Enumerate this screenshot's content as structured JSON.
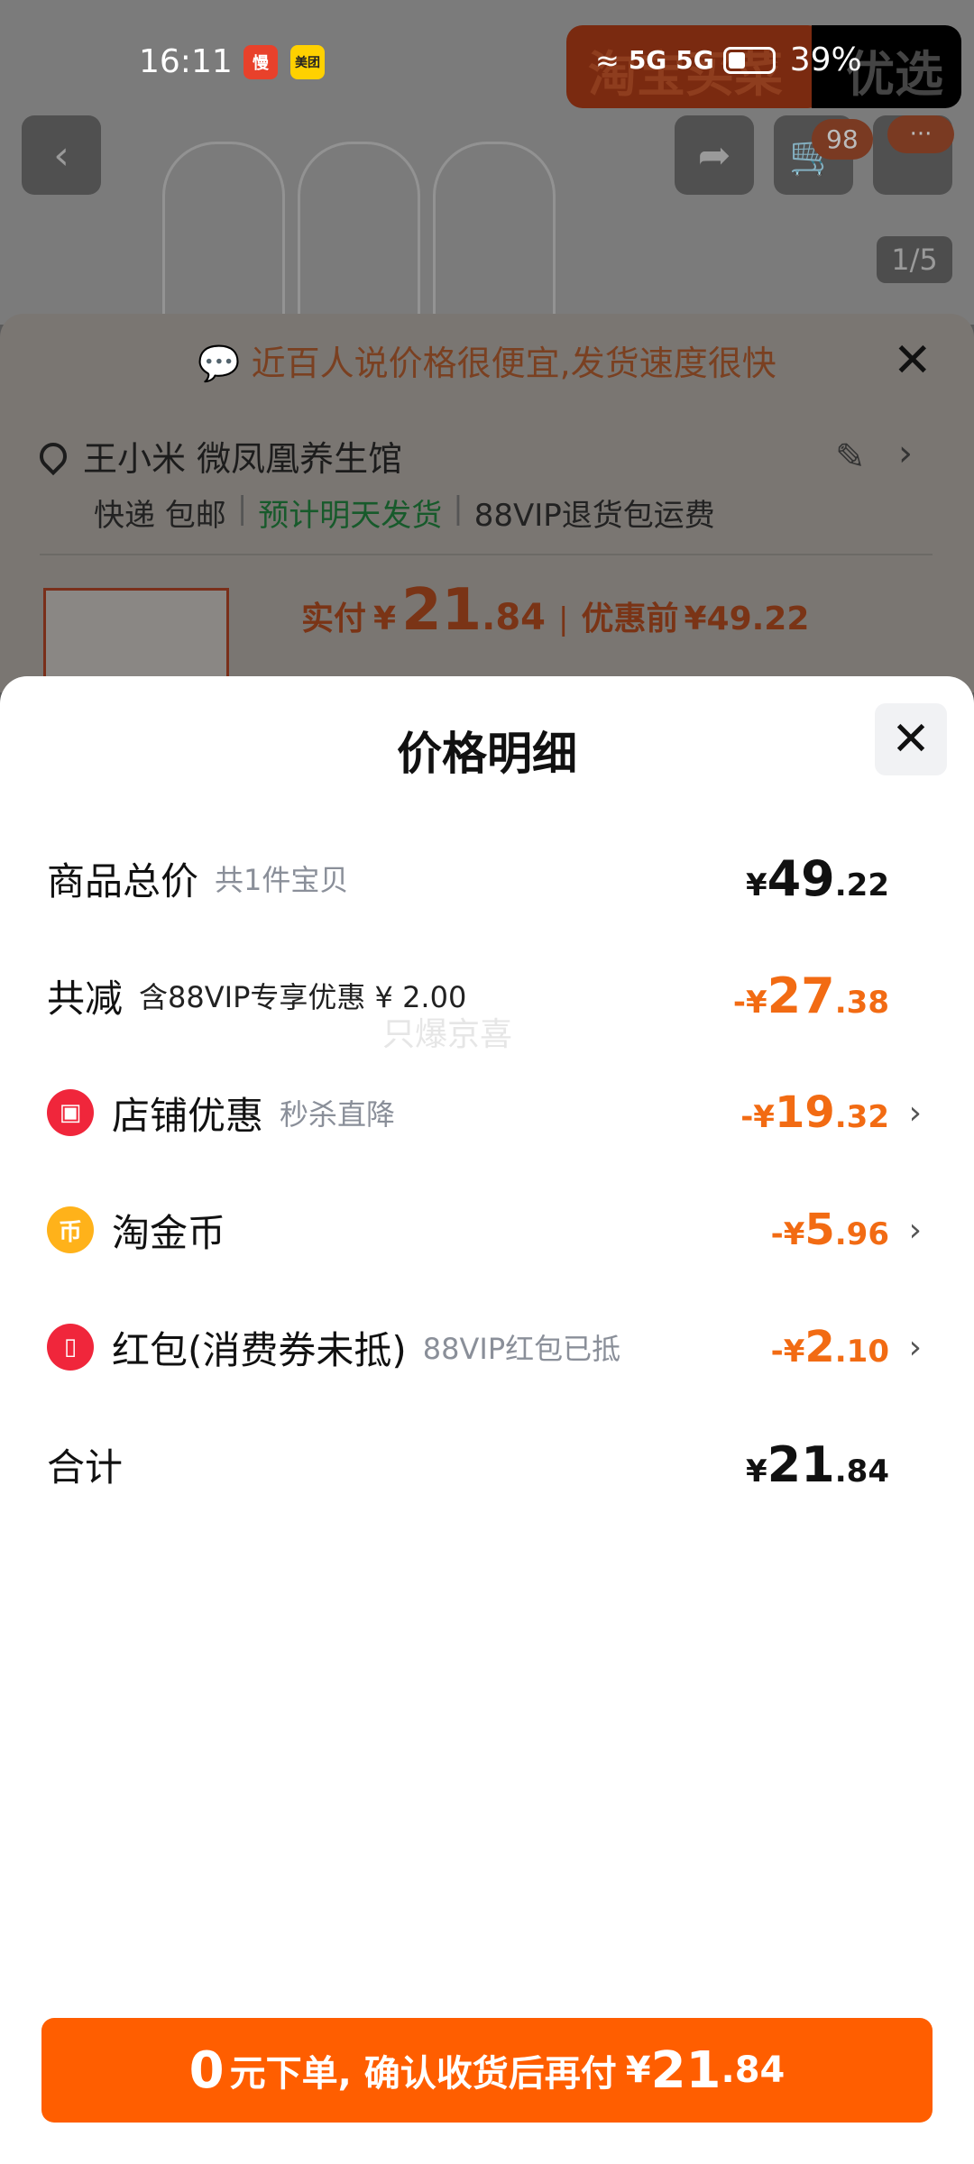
{
  "status_bar": {
    "time": "16:11",
    "app_icons": [
      {
        "name": "taobao-flash-icon",
        "label": "慢",
        "color": "#e8412b"
      },
      {
        "name": "meituan-icon",
        "label": "美团",
        "color": "#ffd100"
      }
    ],
    "signal1": "5G",
    "signal2": "5G",
    "battery_percent": "39%",
    "battery_level": 0.39
  },
  "background": {
    "banner_left": "淘宝买菜",
    "banner_right": "优选",
    "cart_count": "98",
    "more": "···",
    "image_counter": "1/5",
    "tip": "近百人说价格很便宜,发货速度很快",
    "address_name": "王小米 微凤凰养生馆",
    "shipping": [
      "快递 包邮",
      "预计明天发货",
      "88VIP退货包运费"
    ],
    "price_prefix": "实付",
    "price_yen": "¥",
    "price_int": "21",
    "price_dec": ".84",
    "price_before_label": "优惠前",
    "price_before": "¥49.22"
  },
  "popup": {
    "title": "价格明细",
    "watermark": "只爆京喜",
    "rows": [
      {
        "label": "商品总价",
        "sub": "共1件宝贝",
        "yen": "¥",
        "int": "49",
        "dec": ".22"
      },
      {
        "label": "共减",
        "sub": "含88VIP专享优惠 ¥ 2.00",
        "yen": "-¥",
        "int": "27",
        "dec": ".38"
      },
      {
        "label": "店铺优惠",
        "sub": "秒杀直降",
        "yen": "-¥",
        "int": "19",
        "dec": ".32",
        "icon": "shop-icon"
      },
      {
        "label": "淘金币",
        "sub": "",
        "yen": "-¥",
        "int": "5",
        "dec": ".96",
        "icon": "coin-icon"
      },
      {
        "label": "红包(消费券未抵)",
        "sub": "88VIP红包已抵",
        "yen": "-¥",
        "int": "2",
        "dec": ".10",
        "icon": "red-packet-icon"
      },
      {
        "label": "合计",
        "sub": "",
        "yen": "¥",
        "int": "21",
        "dec": ".84"
      }
    ]
  },
  "cta": {
    "zero": "0",
    "text": "元下单, 确认收货后再付",
    "yen": "¥",
    "int": "21",
    "dec": ".84"
  },
  "colors": {
    "accent": "#ff5e00",
    "discount": "#f26b13"
  }
}
